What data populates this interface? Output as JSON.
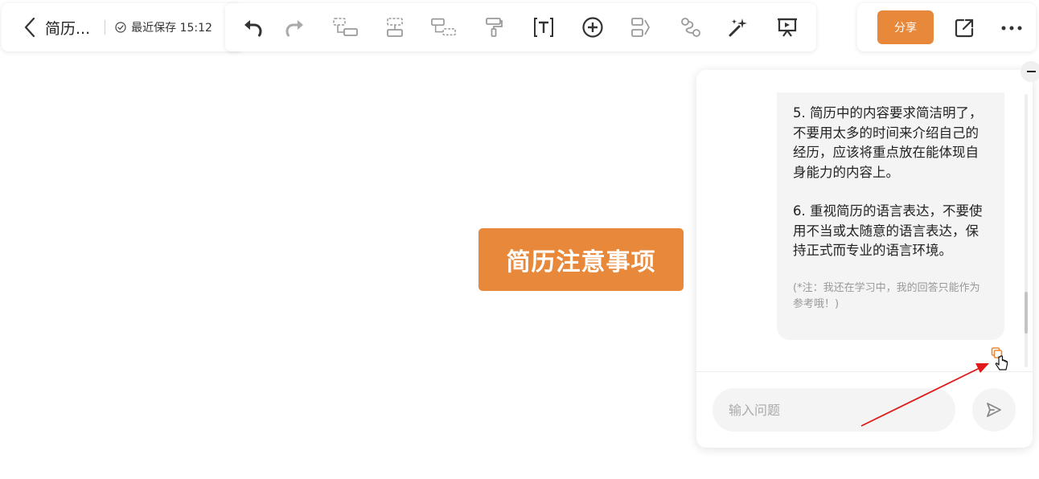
{
  "header": {
    "doc_title": "简历...",
    "save_status": "最近保存 15:12"
  },
  "toolbar": {
    "tools": [
      {
        "id": "undo",
        "icon": "undo-icon"
      },
      {
        "id": "redo",
        "icon": "redo-icon"
      },
      {
        "id": "insert-child",
        "icon": "child-node-icon"
      },
      {
        "id": "insert-sibling",
        "icon": "sibling-node-icon"
      },
      {
        "id": "insert-parent",
        "icon": "parent-node-icon"
      },
      {
        "id": "format-painter",
        "icon": "format-painter-icon"
      },
      {
        "id": "text-style",
        "icon": "text-icon"
      },
      {
        "id": "insert",
        "icon": "plus-circle-icon"
      },
      {
        "id": "summary",
        "icon": "summary-icon"
      },
      {
        "id": "relation",
        "icon": "relation-icon"
      },
      {
        "id": "ai-magic",
        "icon": "magic-wand-icon"
      },
      {
        "id": "present",
        "icon": "presentation-icon"
      }
    ]
  },
  "actions": {
    "share_label": "分享",
    "export_icon": "external-link-icon",
    "more_icon": "more-icon"
  },
  "canvas": {
    "root_node": "简历注意事项"
  },
  "chat": {
    "messages": {
      "p5": "5. 简历中的内容要求简洁明了，不要用太多的时间来介绍自己的经历，应该将重点放在能体现自身能力的内容上。",
      "p6": "6. 重视简历的语言表达，不要使用不当或太随意的语言表达，保持正式而专业的语言环境。",
      "note": "(*注：我还在学习中，我的回答只能作为参考哦！)"
    },
    "input_placeholder": "输入问题",
    "input_value": ""
  },
  "colors": {
    "accent": "#e8883a",
    "annotation_arrow": "#e01818",
    "bubble_bg": "#f4f4f4"
  }
}
